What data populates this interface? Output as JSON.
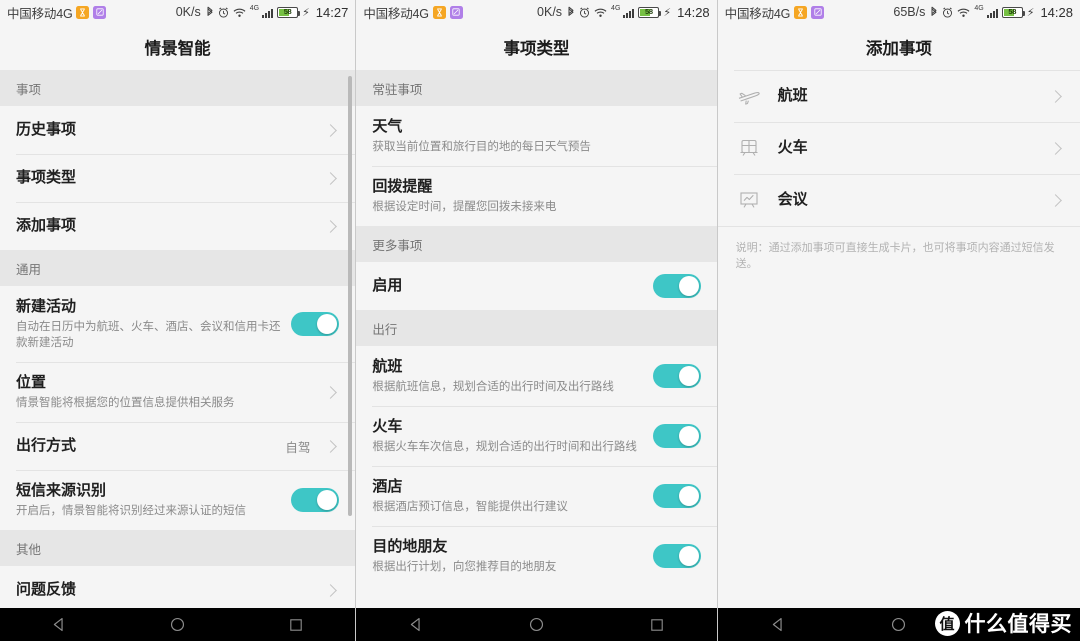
{
  "panels": [
    {
      "status": {
        "carrier": "中国移动4G",
        "chips": [
          "hourglass-chip",
          "vpn-chip"
        ],
        "net_speed": "0K/s",
        "icons": [
          "bluetooth-icon",
          "alarm-icon",
          "wifi-icon",
          "signal-4g-icon"
        ],
        "signal_label": "4G",
        "battery_percent": "58",
        "charging": true,
        "time": "14:27"
      },
      "title": "情景智能",
      "sections": [
        {
          "header": "事项",
          "rows": [
            {
              "title": "历史事项",
              "sub": "",
              "control": "chevron"
            },
            {
              "title": "事项类型",
              "sub": "",
              "control": "chevron"
            },
            {
              "title": "添加事项",
              "sub": "",
              "control": "chevron"
            }
          ]
        },
        {
          "header": "通用",
          "rows": [
            {
              "title": "新建活动",
              "sub": "自动在日历中为航班、火车、酒店、会议和信用卡还款新建活动",
              "control": "toggle",
              "toggle_on": true
            },
            {
              "title": "位置",
              "sub": "情景智能将根据您的位置信息提供相关服务",
              "control": "chevron"
            },
            {
              "title": "出行方式",
              "sub": "",
              "value": "自驾",
              "control": "chevron"
            },
            {
              "title": "短信来源识别",
              "sub": "开启后，情景智能将识别经过来源认证的短信",
              "control": "toggle",
              "toggle_on": true
            }
          ]
        },
        {
          "header": "其他",
          "rows": [
            {
              "title": "问题反馈",
              "sub": "",
              "control": "chevron"
            }
          ]
        }
      ]
    },
    {
      "status": {
        "carrier": "中国移动4G",
        "chips": [
          "hourglass-chip",
          "vpn-chip"
        ],
        "net_speed": "0K/s",
        "icons": [
          "bluetooth-icon",
          "alarm-icon",
          "wifi-icon",
          "signal-4g-icon"
        ],
        "signal_label": "4G",
        "battery_percent": "58",
        "charging": true,
        "time": "14:28"
      },
      "title": "事项类型",
      "sections": [
        {
          "header": "常驻事项",
          "rows": [
            {
              "title": "天气",
              "sub": "获取当前位置和旅行目的地的每日天气预告",
              "control": "none"
            },
            {
              "title": "回拨提醒",
              "sub": "根据设定时间，提醒您回拨未接来电",
              "control": "none"
            }
          ]
        },
        {
          "header": "更多事项",
          "rows": [
            {
              "title": "启用",
              "sub": "",
              "control": "toggle",
              "toggle_on": true
            }
          ]
        },
        {
          "header": "出行",
          "rows": [
            {
              "title": "航班",
              "sub": "根据航班信息，规划合适的出行时间及出行路线",
              "control": "toggle",
              "toggle_on": true
            },
            {
              "title": "火车",
              "sub": "根据火车车次信息，规划合适的出行时间和出行路线",
              "control": "toggle",
              "toggle_on": true
            },
            {
              "title": "酒店",
              "sub": "根据酒店预订信息，智能提供出行建议",
              "control": "toggle",
              "toggle_on": true
            },
            {
              "title": "目的地朋友",
              "sub": "根据出行计划，向您推荐目的地朋友",
              "control": "toggle",
              "toggle_on": true
            }
          ]
        }
      ]
    },
    {
      "status": {
        "carrier": "中国移动4G",
        "chips": [
          "hourglass-chip",
          "vpn-chip"
        ],
        "net_speed": "65B/s",
        "icons": [
          "bluetooth-icon",
          "alarm-icon",
          "wifi-icon",
          "signal-4g-icon"
        ],
        "signal_label": "4G",
        "battery_percent": "58",
        "charging": true,
        "time": "14:28"
      },
      "title": "添加事项",
      "items": [
        {
          "icon": "airplane-icon",
          "label": "航班"
        },
        {
          "icon": "train-icon",
          "label": "火车"
        },
        {
          "icon": "meeting-board-icon",
          "label": "会议"
        }
      ],
      "note": "说明：通过添加事项可直接生成卡片，也可将事项内容通过短信发送。"
    }
  ],
  "navbar": {
    "back": "back-triangle-icon",
    "home": "home-circle-icon",
    "recents": "recents-square-icon"
  },
  "watermark": {
    "badge": "值",
    "text": "什么值得买"
  },
  "colors": {
    "accent_toggle": "#3ec6c6",
    "section_header_bg": "#e6e6e6",
    "content_bg": "#f5f5f5",
    "battery_green": "#76c043"
  }
}
